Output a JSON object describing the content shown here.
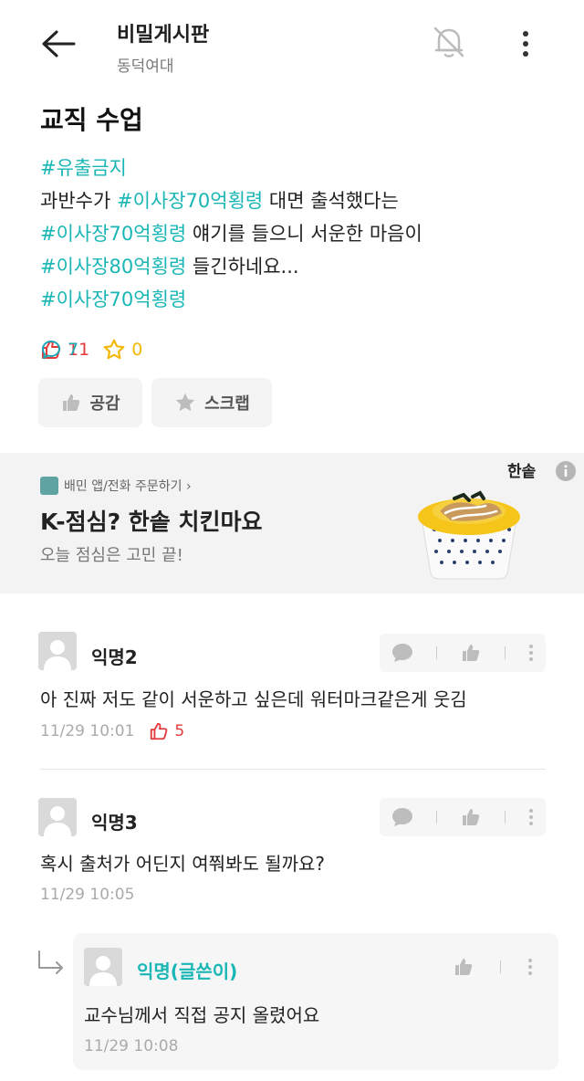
{
  "header": {
    "title": "비밀게시판",
    "subtitle": "동덕여대"
  },
  "post": {
    "title": "교직 수업",
    "lines": [
      [
        {
          "t": "#유출금지",
          "tag": true
        }
      ],
      [
        {
          "t": "과반수가 ",
          "tag": false
        },
        {
          "t": "#이사장70억횡령",
          "tag": true
        },
        {
          "t": " 대면 출석했다는",
          "tag": false
        }
      ],
      [
        {
          "t": "#이사장70억횡령",
          "tag": true
        },
        {
          "t": " 얘기를 들으니 서운한 마음이",
          "tag": false
        }
      ],
      [
        {
          "t": "#이사장80억횡령",
          "tag": true
        },
        {
          "t": " 들긴하네요...",
          "tag": false
        }
      ],
      [
        {
          "t": "#이사장70억횡령",
          "tag": true
        }
      ]
    ],
    "likes": "11",
    "comments": "7",
    "scraps": "0",
    "like_button": "공감",
    "scrap_button": "스크랩"
  },
  "ad": {
    "brand": "한솥",
    "link_text": "배민 앱/전화 주문하기 ›",
    "title": "K-점심? 한솥 치킨마요",
    "description": "오늘 점심은 고민 끝!"
  },
  "comments": [
    {
      "name": "익명2",
      "text": "아 진짜 저도 같이 서운하고 싶은데 워터마크같은게 웃김",
      "time": "11/29 10:01",
      "likes": "5"
    },
    {
      "name": "익명3",
      "text": "혹시 출처가 어딘지 여쭤봐도 될까요?",
      "time": "11/29 10:05"
    }
  ],
  "reply": {
    "name": "익명(글쓴이)",
    "text": "교수님께서 직접 공지 올렸어요",
    "time": "11/29 10:08"
  },
  "colors": {
    "accent": "#1ab6b6",
    "like": "#e2393b",
    "comment": "#1aa7b5",
    "scrap": "#f2b708"
  }
}
